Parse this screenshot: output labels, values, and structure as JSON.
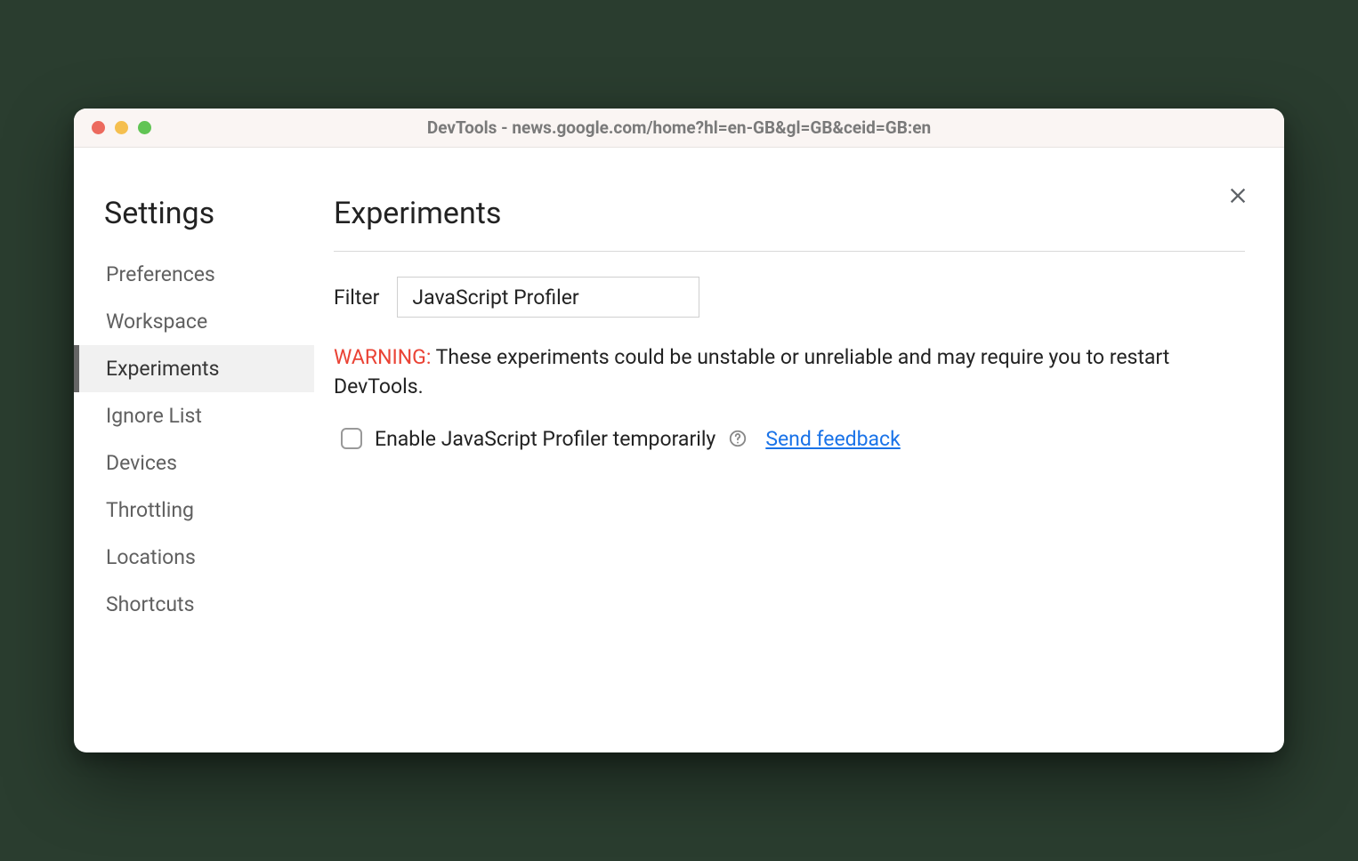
{
  "window": {
    "title": "DevTools - news.google.com/home?hl=en-GB&gl=GB&ceid=GB:en"
  },
  "sidebar": {
    "title": "Settings",
    "items": [
      {
        "label": "Preferences",
        "active": false
      },
      {
        "label": "Workspace",
        "active": false
      },
      {
        "label": "Experiments",
        "active": true
      },
      {
        "label": "Ignore List",
        "active": false
      },
      {
        "label": "Devices",
        "active": false
      },
      {
        "label": "Throttling",
        "active": false
      },
      {
        "label": "Locations",
        "active": false
      },
      {
        "label": "Shortcuts",
        "active": false
      }
    ]
  },
  "main": {
    "title": "Experiments",
    "filter": {
      "label": "Filter",
      "value": "JavaScript Profiler"
    },
    "warning": {
      "prefix": "WARNING:",
      "text": " These experiments could be unstable or unreliable and may require you to restart DevTools."
    },
    "experiments": [
      {
        "label": "Enable JavaScript Profiler temporarily",
        "checked": false,
        "feedback_label": "Send feedback"
      }
    ]
  }
}
